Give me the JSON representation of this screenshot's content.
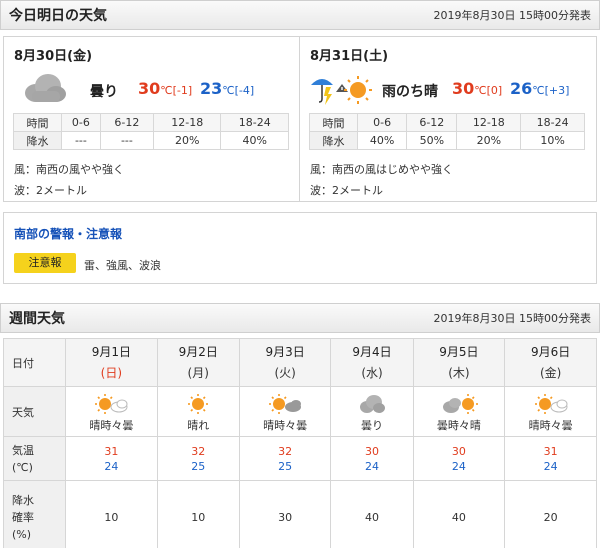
{
  "today_tomorrow": {
    "title": "今日明日の天気",
    "issued": "2019年8月30日 15時00分発表",
    "days": [
      {
        "date": "8月30日(金)",
        "weather": "曇り",
        "icon": "cloud-icon",
        "high": "30",
        "high_unit_diff": "℃[-1]",
        "low": "23",
        "low_unit_diff": "℃[-4]",
        "rain_header": [
          "時間",
          "0-6",
          "6-12",
          "12-18",
          "18-24"
        ],
        "rain_row": [
          "降水",
          "---",
          "---",
          "20%",
          "40%"
        ],
        "wind": "風：南西の風やや強く",
        "wave": "波：2メートル"
      },
      {
        "date": "8月31日(土)",
        "weather": "雨のち晴",
        "icon": "rain-then-sun-icon",
        "high": "30",
        "high_unit_diff": "℃[0]",
        "low": "26",
        "low_unit_diff": "℃[+3]",
        "rain_header": [
          "時間",
          "0-6",
          "6-12",
          "12-18",
          "18-24"
        ],
        "rain_row": [
          "降水",
          "40%",
          "50%",
          "20%",
          "10%"
        ],
        "wind": "風：南西の風はじめやや強く",
        "wave": "波：2メートル"
      }
    ]
  },
  "warnings": {
    "title": "南部の警報・注意報",
    "badge": "注意報",
    "text": "雷、強風、波浪",
    "badge_color": "#f5d21c"
  },
  "weekly": {
    "title": "週間天気",
    "issued": "2019年8月30日 15時00分発表",
    "labels": {
      "date": "日付",
      "weather": "天気",
      "temp_line1": "気温",
      "temp_line2": "(℃)",
      "rain_line1": "降水",
      "rain_line2": "確率",
      "rain_line3": "(%)"
    },
    "days": [
      {
        "date": "9月1日",
        "dow": "(日)",
        "weather": "晴時々曇",
        "icon": "sun-cloud-icon",
        "high": "31",
        "low": "24",
        "rain": "10"
      },
      {
        "date": "9月2日",
        "dow": "(月)",
        "weather": "晴れ",
        "icon": "sun-icon",
        "high": "32",
        "low": "25",
        "rain": "10"
      },
      {
        "date": "9月3日",
        "dow": "(火)",
        "weather": "晴時々曇",
        "icon": "sun-cloud-icon",
        "high": "32",
        "low": "25",
        "rain": "30"
      },
      {
        "date": "9月4日",
        "dow": "(水)",
        "weather": "曇り",
        "icon": "cloud-icon",
        "high": "30",
        "low": "24",
        "rain": "40"
      },
      {
        "date": "9月5日",
        "dow": "(木)",
        "weather": "曇時々晴",
        "icon": "cloud-sun-icon",
        "high": "30",
        "low": "24",
        "rain": "40"
      },
      {
        "date": "9月6日",
        "dow": "(金)",
        "weather": "晴時々曇",
        "icon": "sun-cloud-icon",
        "high": "31",
        "low": "24",
        "rain": "20"
      }
    ]
  },
  "colors": {
    "high": "#e03c1e",
    "low": "#1c62c7",
    "link": "#1652b8"
  }
}
